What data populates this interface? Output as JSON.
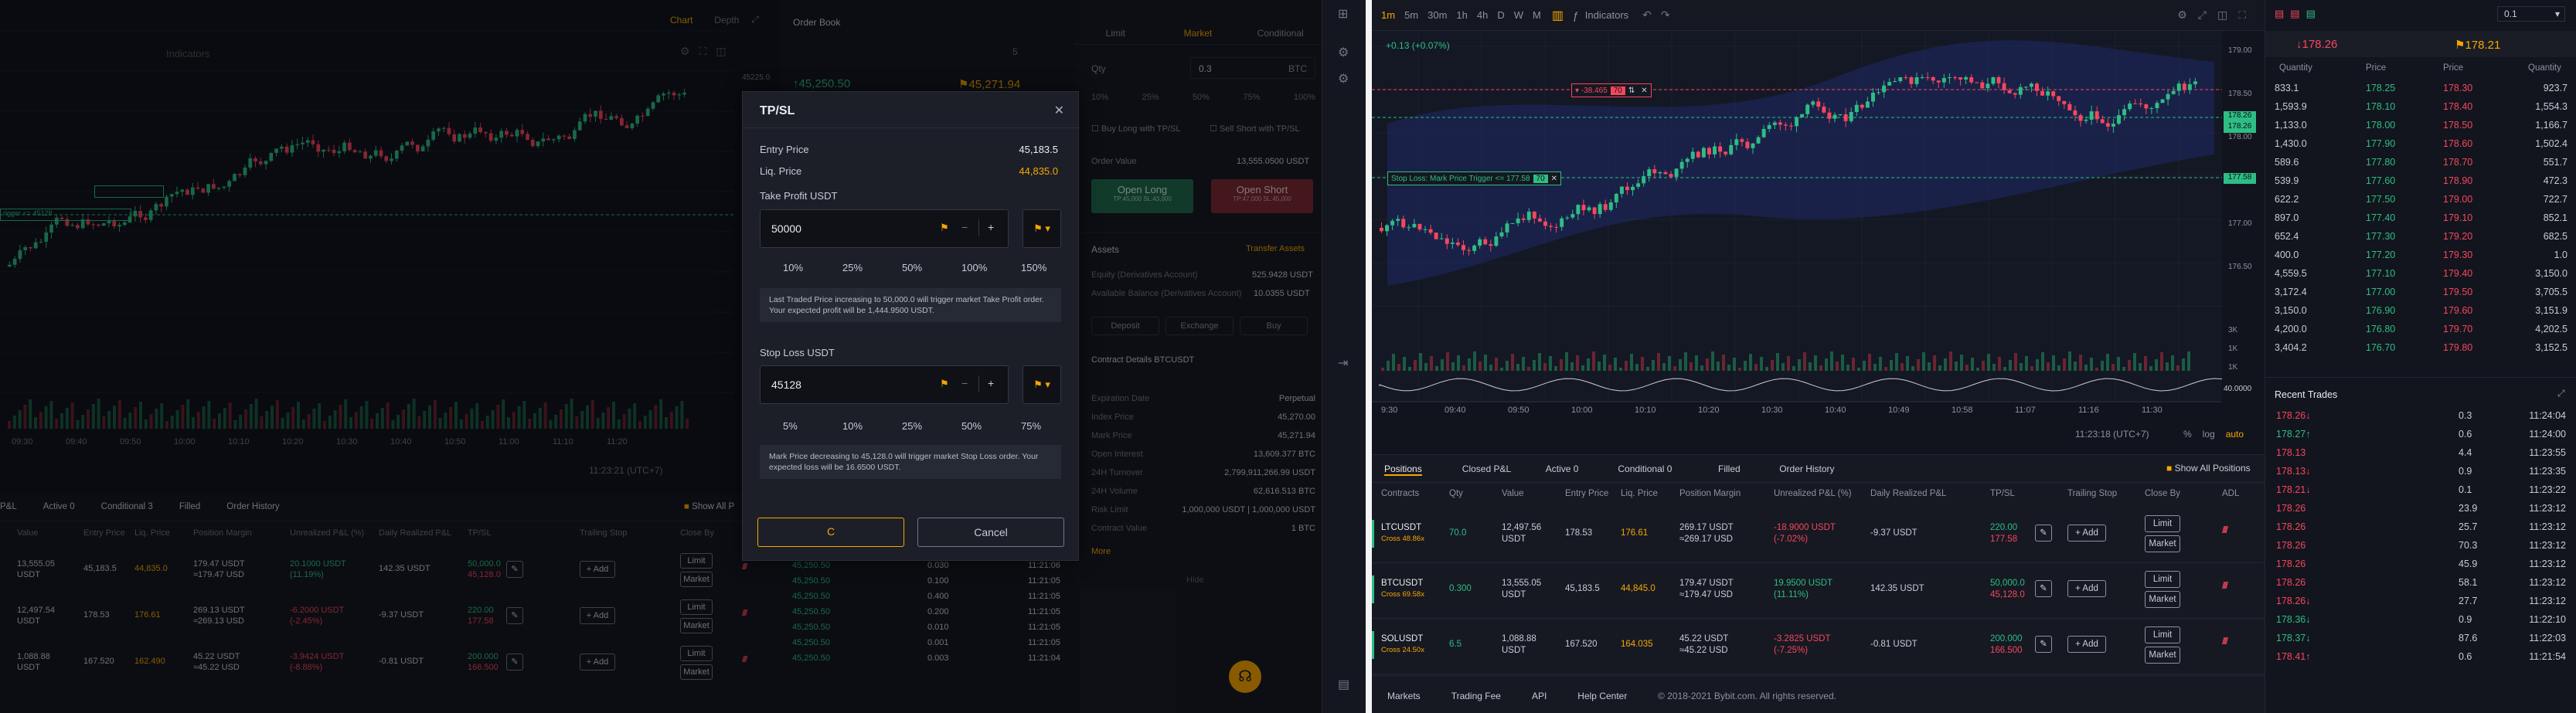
{
  "left": {
    "chart_tabs": [
      "Chart",
      "Depth"
    ],
    "orderbook_title": "Order Book",
    "orderbook_qty": "5",
    "indicators": "Indicators",
    "price_45225": "45225.0",
    "ob_price_green": "↑45,250.50",
    "ob_price_mark": "⚑45,271.94",
    "time_axis": [
      "09:30",
      "09:40",
      "09:50",
      "10:00",
      "10:10",
      "10:20",
      "10:30",
      "10:40",
      "10:50",
      "11:00",
      "11:10",
      "11:20"
    ],
    "chart_time": "11:23:21 (UTC+7)",
    "order_tabs": [
      "Limit",
      "Market",
      "Conditional"
    ],
    "qty_label": "Qty",
    "qty_value": "0.3",
    "qty_unit": "BTC",
    "qty_pcts": [
      "10%",
      "25%",
      "50%",
      "75%",
      "100%"
    ],
    "buy_long_tpsl": "Buy Long with TP/SL",
    "sell_short_tpsl": "Sell Short with TP/SL",
    "order_value_label": "Order Value",
    "order_value": "13,555.0500 USDT",
    "open_long": "Open Long",
    "open_long_sub": "TP:45,000 SL:43,000",
    "open_short": "Open Short",
    "open_short_sub": "TP:47,000 SL:45,000",
    "assets_label": "Assets",
    "transfer_assets": "Transfer Assets",
    "equity_label": "Equity (Derivatives Account)",
    "equity_value": "525.9428 USDT",
    "avail_label": "Available Balance (Derivatives Account)",
    "avail_value": "10.0355 USDT",
    "asset_btns": [
      "Deposit",
      "Exchange",
      "Buy"
    ],
    "contract_details": "Contract Details BTCUSDT",
    "details": [
      {
        "label": "Expiration Date",
        "value": "Perpetual"
      },
      {
        "label": "Index Price",
        "value": "45,270.00"
      },
      {
        "label": "Mark Price",
        "value": "45,271.94"
      },
      {
        "label": "Open Interest",
        "value": "13,609.377 BTC"
      },
      {
        "label": "24H Turnover",
        "value": "2,799,911,266.99 USDT"
      },
      {
        "label": "24H Volume",
        "value": "62,616.513 BTC"
      },
      {
        "label": "Risk Limit",
        "value": "1,000,000 USDT | 1,000,000 USDT"
      },
      {
        "label": "Contract Value",
        "value": "1 BTC"
      }
    ],
    "more": "More",
    "hide": "Hide",
    "positions_tabs": [
      "P&L",
      "Active 0",
      "Conditional 3",
      "Filled",
      "Order History"
    ],
    "show_all": "Show All P",
    "pos_headers": [
      "Value",
      "Entry Price",
      "Liq. Price",
      "Position Margin",
      "Unrealized P&L (%)",
      "Daily Realized P&L",
      "TP/SL",
      "Trailing Stop",
      "Close By"
    ],
    "positions": [
      {
        "value": "13,555.05 USDT",
        "entry": "45,183.5",
        "liq": "44,835.0",
        "margin1": "179.47 USDT",
        "margin2": "≈179.47 USD",
        "pnl1": "20.1000 USDT",
        "pnl2": "(11.19%)",
        "realized": "142.35 USDT",
        "tp": "50,000.0",
        "sl": "45,128.0"
      },
      {
        "value": "12,497.54 USDT",
        "entry": "178.53",
        "liq": "176.61",
        "margin1": "269.13 USDT",
        "margin2": "≈269.13 USD",
        "pnl1": "-6.2000 USDT",
        "pnl2": "(-2.45%)",
        "realized": "-9.37 USDT",
        "tp": "220.00",
        "sl": "177.58"
      },
      {
        "value": "1,088.88 USDT",
        "entry": "167.520",
        "liq": "162.490",
        "margin1": "45.22 USDT",
        "margin2": "≈45.22 USD",
        "pnl1": "-3.9424 USDT",
        "pnl2": "(-8.88%)",
        "realized": "-0.81 USDT",
        "tp": "200.000",
        "sl": "166.500"
      }
    ],
    "add_label": "Add",
    "limit_label": "Limit",
    "market_label": "Market",
    "trades": [
      {
        "price": "45,250.50",
        "qty": "0.030",
        "time": "11:21:06"
      },
      {
        "price": "45,250.50",
        "qty": "0.100",
        "time": "11:21:05"
      },
      {
        "price": "45,250.50",
        "qty": "0.400",
        "time": "11:21:05"
      },
      {
        "price": "45,250.50",
        "qty": "0.200",
        "time": "11:21:05"
      },
      {
        "price": "45,250.50",
        "qty": "0.010",
        "time": "11:21:05"
      },
      {
        "price": "45,250.50",
        "qty": "0.001",
        "time": "11:21:05"
      },
      {
        "price": "45,250.50",
        "qty": "0.003",
        "time": "11:21:04"
      }
    ]
  },
  "modal": {
    "title": "TP/SL",
    "entry_label": "Entry Price",
    "entry_value": "45,183.5",
    "liq_label": "Liq. Price",
    "liq_value": "44,835.0",
    "tp_label": "Take Profit  USDT",
    "tp_value": "50000",
    "tp_pcts": [
      "10%",
      "25%",
      "50%",
      "100%",
      "150%"
    ],
    "tp_note": "Last Traded Price increasing to 50,000.0 will trigger market Take Profit order. Your expected profit will be 1,444.9500 USDT.",
    "sl_label": "Stop Loss  USDT",
    "sl_value": "45128",
    "sl_pcts": [
      "5%",
      "10%",
      "25%",
      "50%",
      "75%"
    ],
    "sl_note": "Mark Price decreasing to 45,128.0 will trigger market Stop Loss order. Your expected loss will be 16.6500 USDT.",
    "confirm": "C",
    "cancel": "Cancel"
  },
  "right": {
    "intervals": [
      "1m",
      "5m",
      "30m",
      "1h",
      "4h",
      "D",
      "W",
      "M"
    ],
    "indicators": "Indicators",
    "ohlc_change": "+0.13 (+0.07%)",
    "right_qty": "0.1",
    "price_down": "↓178.26",
    "price_mark": "⚑178.21",
    "ob_headers": [
      "Quantity",
      "Price",
      "Price",
      "Quantity"
    ],
    "orderbook": [
      {
        "q1": "833.1",
        "p1": "178.25",
        "p2": "178.30",
        "q2": "923.7"
      },
      {
        "q1": "1,593.9",
        "p1": "178.10",
        "p2": "178.40",
        "q2": "1,554.3"
      },
      {
        "q1": "1,133.0",
        "p1": "178.00",
        "p2": "178.50",
        "q2": "1,166.7"
      },
      {
        "q1": "1,430.0",
        "p1": "177.90",
        "p2": "178.60",
        "q2": "1,502.4"
      },
      {
        "q1": "589.6",
        "p1": "177.80",
        "p2": "178.70",
        "q2": "551.7"
      },
      {
        "q1": "539.9",
        "p1": "177.60",
        "p2": "178.90",
        "q2": "472.3"
      },
      {
        "q1": "622.2",
        "p1": "177.50",
        "p2": "179.00",
        "q2": "722.7"
      },
      {
        "q1": "897.0",
        "p1": "177.40",
        "p2": "179.10",
        "q2": "852.1"
      },
      {
        "q1": "652.4",
        "p1": "177.30",
        "p2": "179.20",
        "q2": "682.5"
      },
      {
        "q1": "400.0",
        "p1": "177.20",
        "p2": "179.30",
        "q2": "1.0"
      },
      {
        "q1": "4,559.5",
        "p1": "177.10",
        "p2": "179.40",
        "q2": "3,150.0"
      },
      {
        "q1": "3,172.4",
        "p1": "177.00",
        "p2": "179.50",
        "q2": "3,705.5"
      },
      {
        "q1": "3,150.0",
        "p1": "176.90",
        "p2": "179.60",
        "q2": "3,151.9"
      },
      {
        "q1": "4,200.0",
        "p1": "176.80",
        "p2": "179.70",
        "q2": "4,202.5"
      },
      {
        "q1": "3,404.2",
        "p1": "176.70",
        "p2": "179.80",
        "q2": "3,152.5"
      }
    ],
    "recent_trades_title": "Recent Trades",
    "recent_trades": [
      {
        "price": "178.26↓",
        "qty": "0.3",
        "time": "11:24:04",
        "dir": "down"
      },
      {
        "price": "178.27↑",
        "qty": "0.6",
        "time": "11:24:00",
        "dir": "up"
      },
      {
        "price": "178.13",
        "qty": "4.4",
        "time": "11:23:55",
        "dir": "down"
      },
      {
        "price": "178.13↓",
        "qty": "0.9",
        "time": "11:23:35",
        "dir": "down"
      },
      {
        "price": "178.21↓",
        "qty": "0.1",
        "time": "11:23:22",
        "dir": "down"
      },
      {
        "price": "178.26",
        "qty": "23.9",
        "time": "11:23:12",
        "dir": "down"
      },
      {
        "price": "178.26",
        "qty": "25.7",
        "time": "11:23:12",
        "dir": "down"
      },
      {
        "price": "178.26",
        "qty": "70.3",
        "time": "11:23:12",
        "dir": "down"
      },
      {
        "price": "178.26",
        "qty": "45.9",
        "time": "11:23:12",
        "dir": "down"
      },
      {
        "price": "178.26",
        "qty": "58.1",
        "time": "11:23:12",
        "dir": "down"
      },
      {
        "price": "178.26↓",
        "qty": "27.7",
        "time": "11:23:12",
        "dir": "down"
      },
      {
        "price": "178.36↓",
        "qty": "0.9",
        "time": "11:22:10",
        "dir": "up"
      },
      {
        "price": "178.37↓",
        "qty": "87.6",
        "time": "11:22:03",
        "dir": "up"
      },
      {
        "price": "178.41↑",
        "qty": "0.6",
        "time": "11:21:54",
        "dir": "down"
      }
    ],
    "y_ticks": [
      "179.00",
      "178.50",
      "178.00",
      "177.50",
      "177.00",
      "176.50"
    ],
    "price_tag_green": "178.26",
    "price_tag_green2": "178.26",
    "price_tag_sl": "177.58",
    "vol_ticks": [
      "3K",
      "1K",
      "1K"
    ],
    "osc_tick": "40.0000",
    "x_ticks": [
      "9:30",
      "09:40",
      "09:50",
      "10:00",
      "10:10",
      "10:20",
      "10:30",
      "10:40",
      "10:49",
      "10:58",
      "11:07",
      "11:16",
      "11:30"
    ],
    "chart_time": "11:23:18 (UTC+7)",
    "chart_opts": [
      "%",
      "log",
      "auto"
    ],
    "tp_tag": "▾ -38.465",
    "tp_tag_qty": "70",
    "sl_tag": "Stop Loss: Mark Price Trigger <= 177.58",
    "sl_tag_qty": "70",
    "pos_tabs": [
      "Positions",
      "Closed P&L",
      "Active 0",
      "Conditional 0",
      "Filled",
      "Order History"
    ],
    "show_all": "Show All Positions",
    "pos_headers": [
      "Contracts",
      "Qty",
      "Value",
      "Entry Price",
      "Liq. Price",
      "Position Margin",
      "Unrealized P&L (%)",
      "Daily Realized P&L",
      "TP/SL",
      "Trailing Stop",
      "Close By",
      "ADL"
    ],
    "positions": [
      {
        "symbol": "LTCUSDT",
        "lev": "Cross 48.86x",
        "qty": "70.0",
        "value1": "12,497.56",
        "value2": "USDT",
        "entry": "178.53",
        "liq": "176.61",
        "margin1": "269.17 USDT",
        "margin2": "≈269.17 USD",
        "pnl1": "-18.9000 USDT",
        "pnl2": "(-7.02%)",
        "realized": "-9.37 USDT",
        "tp": "220.00",
        "sl": "177.58",
        "pnl_dir": "down"
      },
      {
        "symbol": "BTCUSDT",
        "lev": "Cross 69.58x",
        "qty": "0.300",
        "value1": "13,555.05",
        "value2": "USDT",
        "entry": "45,183.5",
        "liq": "44,845.0",
        "margin1": "179.47 USDT",
        "margin2": "≈179.47 USD",
        "pnl1": "19.9500 USDT",
        "pnl2": "(11.11%)",
        "realized": "142.35 USDT",
        "tp": "50,000.0",
        "sl": "45,128.0",
        "pnl_dir": "up"
      },
      {
        "symbol": "SOLUSDT",
        "lev": "Cross 24.50x",
        "qty": "6.5",
        "value1": "1,088.88",
        "value2": "USDT",
        "entry": "167.520",
        "liq": "164.035",
        "margin1": "45.22 USDT",
        "margin2": "≈45.22 USD",
        "pnl1": "-3.2825 USDT",
        "pnl2": "(-7.25%)",
        "realized": "-0.81 USDT",
        "tp": "200.000",
        "sl": "166.500",
        "pnl_dir": "down"
      }
    ],
    "add_label": "Add",
    "limit_label": "Limit",
    "market_label": "Market",
    "footer": [
      "Markets",
      "Trading Fee",
      "API",
      "Help Center"
    ],
    "copyright": "© 2018-2021 Bybit.com. All rights reserved."
  },
  "colors": {
    "green": "#2ebd85",
    "red": "#f6465d",
    "accent": "#f7a600",
    "bg": "#14171f"
  }
}
